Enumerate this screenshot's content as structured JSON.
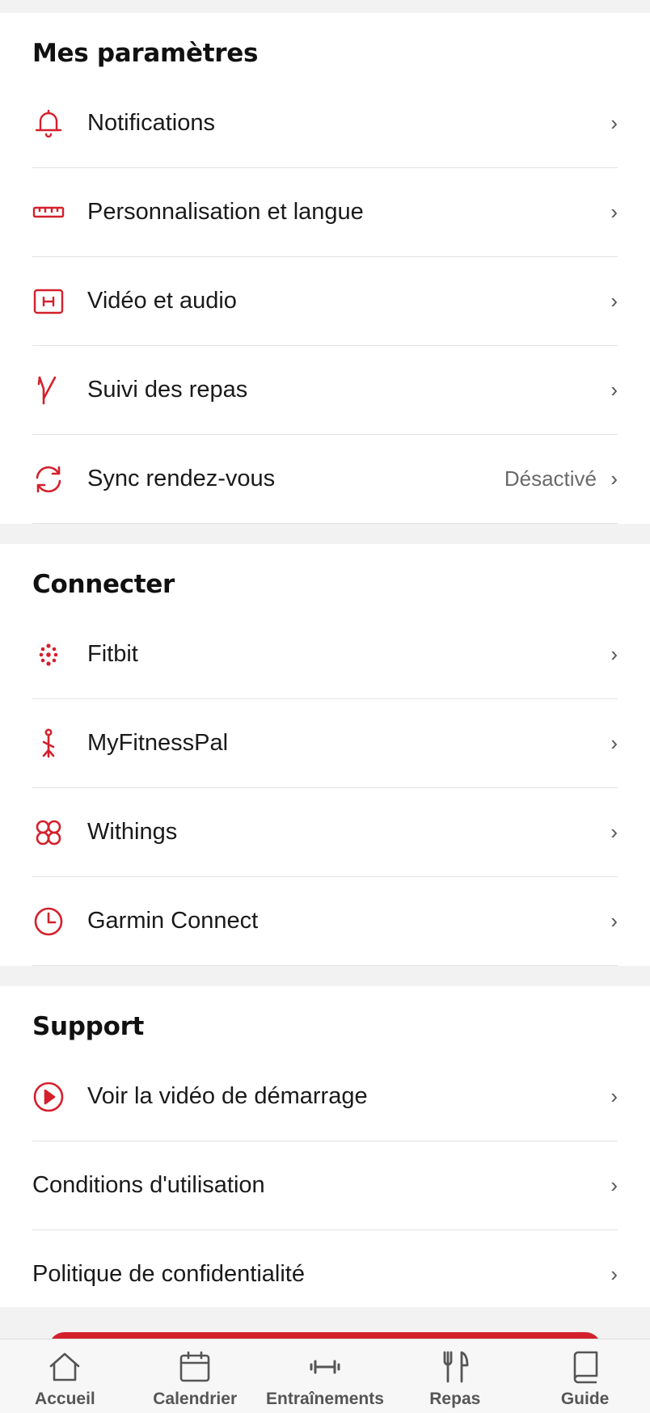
{
  "colors": {
    "accent": "#d4202c",
    "text": "#1a1a1a",
    "muted": "#6a6a6a",
    "divider": "#e2e2e2"
  },
  "settings": {
    "title": "Mes paramètres",
    "items": [
      {
        "label": "Notifications",
        "icon": "bell-icon",
        "value": ""
      },
      {
        "label": "Personnalisation et langue",
        "icon": "ruler-icon",
        "value": ""
      },
      {
        "label": "Vidéo et audio",
        "icon": "video-frame-icon",
        "value": ""
      },
      {
        "label": "Suivi des repas",
        "icon": "meal-tracking-icon",
        "value": ""
      },
      {
        "label": "Sync rendez-vous",
        "icon": "sync-icon",
        "value": "Désactivé"
      }
    ]
  },
  "connect": {
    "title": "Connecter",
    "items": [
      {
        "label": "Fitbit",
        "icon": "fitbit-icon"
      },
      {
        "label": "MyFitnessPal",
        "icon": "myfitnesspal-icon"
      },
      {
        "label": "Withings",
        "icon": "withings-icon"
      },
      {
        "label": "Garmin Connect",
        "icon": "garmin-clock-icon"
      }
    ]
  },
  "support": {
    "title": "Support",
    "items": [
      {
        "label": "Voir la vidéo de démarrage",
        "icon": "play-circle-icon"
      },
      {
        "label": "Conditions d'utilisation"
      },
      {
        "label": "Politique de confidentialité"
      }
    ]
  },
  "chevron": "›",
  "nav": {
    "items": [
      {
        "label": "Accueil",
        "icon": "home-icon"
      },
      {
        "label": "Calendrier",
        "icon": "calendar-icon"
      },
      {
        "label": "Entraînements",
        "icon": "dumbbell-icon"
      },
      {
        "label": "Repas",
        "icon": "utensils-icon"
      },
      {
        "label": "Guide",
        "icon": "book-icon"
      }
    ]
  }
}
